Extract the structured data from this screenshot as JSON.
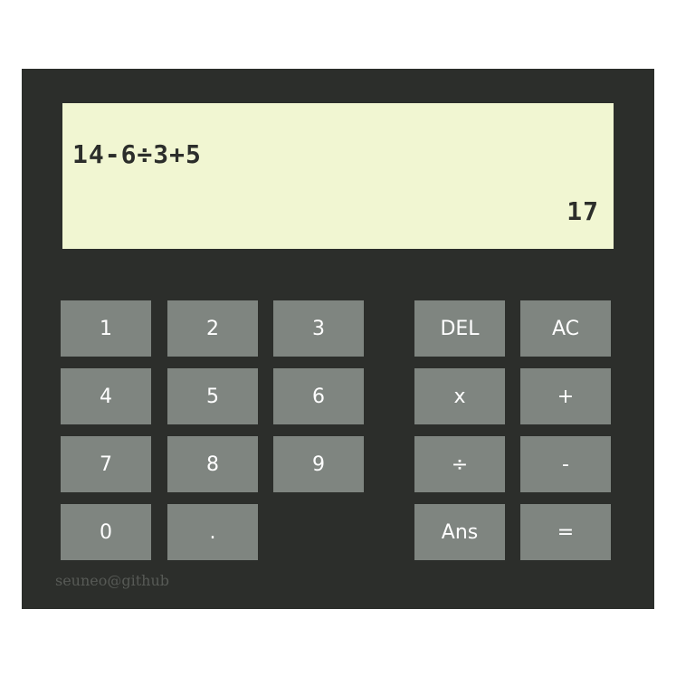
{
  "display": {
    "expression": "14-6÷3+5",
    "result": "17"
  },
  "keys": {
    "k1": "1",
    "k2": "2",
    "k3": "3",
    "k4": "4",
    "k5": "5",
    "k6": "6",
    "k7": "7",
    "k8": "8",
    "k9": "9",
    "k0": "0",
    "dot": ".",
    "del": "DEL",
    "ac": "AC",
    "mul": "x",
    "add": "+",
    "div": "÷",
    "sub": "-",
    "ans": "Ans",
    "eq": "="
  },
  "footer": {
    "credit": "seuneo@github"
  }
}
